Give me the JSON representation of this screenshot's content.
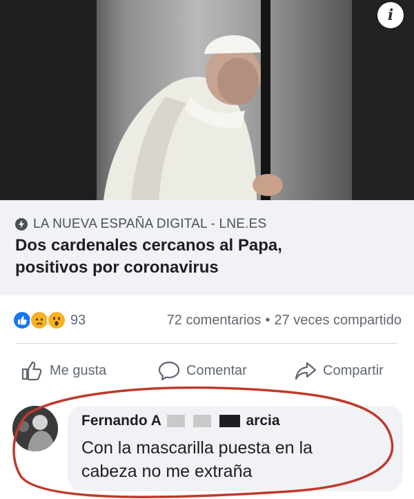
{
  "post": {
    "image_alt": "Papa con solideo blanco apoyado en un báculo",
    "info_icon": "info-icon"
  },
  "link_preview": {
    "source_icon": "lightning-bolt-icon",
    "source": "LA NUEVA ESPAÑA DIGITAL - LNE.ES",
    "headline_line1": "Dos cardenales cercanos al Papa,",
    "headline_line2": "positivos por coronavirus"
  },
  "stats": {
    "reaction_icons": [
      "like-reaction-icon",
      "sad-reaction-icon",
      "wow-reaction-icon"
    ],
    "reaction_count": "93",
    "comments": "72 comentarios",
    "separator": "•",
    "shares": "27 veces compartido"
  },
  "actions": {
    "like_label": "Me gusta",
    "comment_label": "Comentar",
    "share_label": "Compartir"
  },
  "comment": {
    "author_visible_start": "Fernando A",
    "author_visible_end": "arcia",
    "text_line1": "Con la mascarilla puesta en la",
    "text_line2": "cabeza no me extraña"
  },
  "colors": {
    "facebook_blue": "#1877f2",
    "reaction_yellow": "#f7b125",
    "annotation_red": "#c0392b",
    "gray_text": "#606770"
  }
}
